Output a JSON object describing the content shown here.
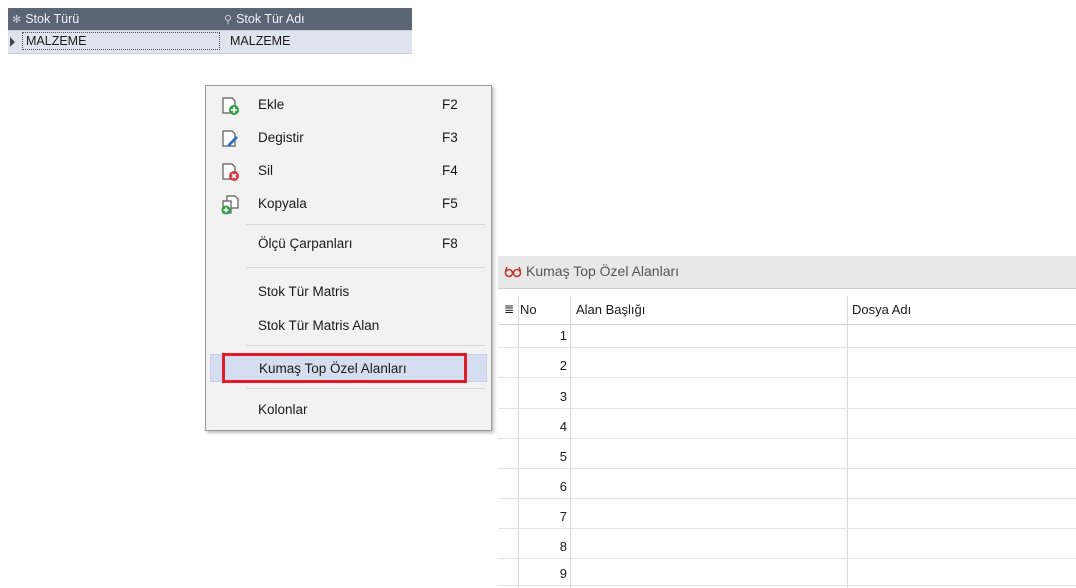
{
  "top_grid": {
    "columns": [
      {
        "label": "Stok Türü",
        "icon": "asterisk-icon"
      },
      {
        "label": "Stok Tür Adı",
        "icon": "filter-icon"
      }
    ],
    "rows": [
      {
        "stok_turu": "MALZEME",
        "stok_tur_adi": "MALZEME"
      }
    ]
  },
  "context_menu": {
    "items": [
      {
        "label": "Ekle",
        "shortcut": "F2",
        "icon": "add-document-icon"
      },
      {
        "label": "Degistir",
        "shortcut": "F3",
        "icon": "edit-document-icon"
      },
      {
        "label": "Sil",
        "shortcut": "F4",
        "icon": "delete-document-icon"
      },
      {
        "label": "Kopyala",
        "shortcut": "F5",
        "icon": "copy-document-icon"
      },
      {
        "label": "Ölçü Çarpanları",
        "shortcut": "F8"
      },
      {
        "label": "Stok Tür Matris",
        "shortcut": ""
      },
      {
        "label": "Stok Tür Matris Alan",
        "shortcut": ""
      },
      {
        "label": "Kumaş Top Özel Alanları",
        "shortcut": "",
        "highlighted": true
      },
      {
        "label": "Kolonlar",
        "shortcut": ""
      }
    ]
  },
  "kumas_panel": {
    "title": "Kumaş Top Özel Alanları",
    "title_icon": "glasses-icon",
    "columns": [
      "No",
      "Alan Başlığı",
      "Dosya Adı"
    ],
    "rows": [
      "1",
      "2",
      "3",
      "4",
      "5",
      "6",
      "7",
      "8",
      "9"
    ]
  },
  "colors": {
    "header_bg": "#5b6474",
    "highlight_box": "#e21b24",
    "selected_row": "#dfe3ee"
  }
}
